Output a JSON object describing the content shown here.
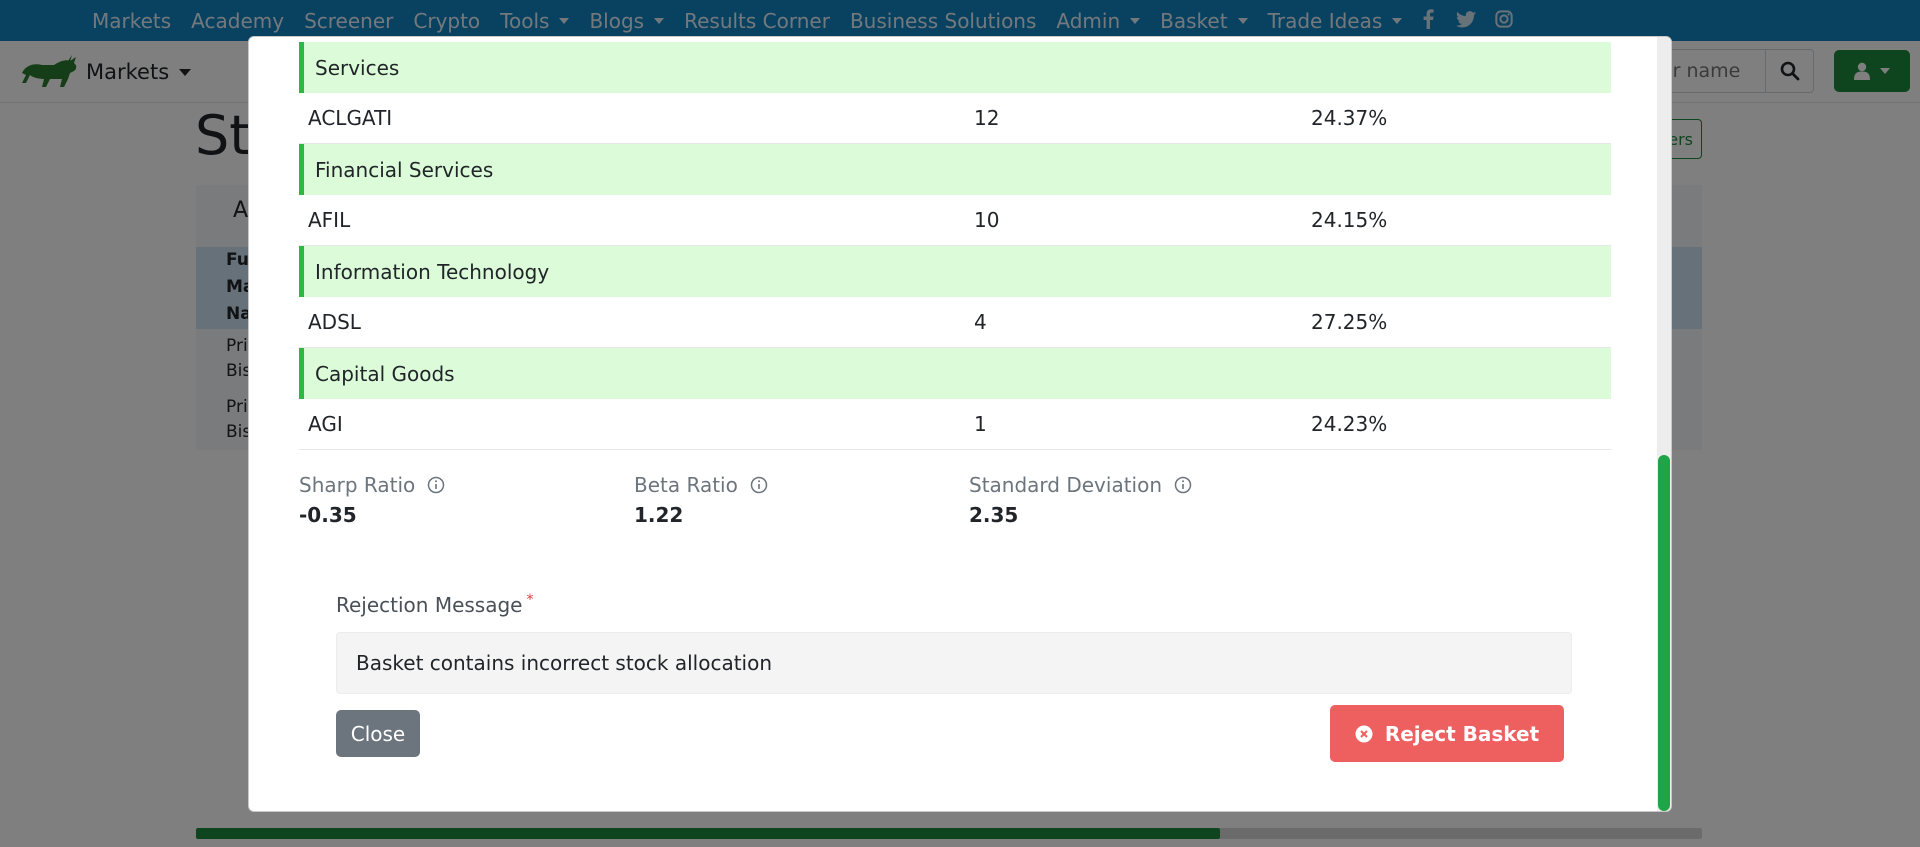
{
  "topnav": {
    "items": [
      {
        "label": "Markets",
        "dropdown": false
      },
      {
        "label": "Academy",
        "dropdown": false
      },
      {
        "label": "Screener",
        "dropdown": false
      },
      {
        "label": "Crypto",
        "dropdown": false
      },
      {
        "label": "Tools",
        "dropdown": true
      },
      {
        "label": "Blogs",
        "dropdown": true
      },
      {
        "label": "Results Corner",
        "dropdown": false
      },
      {
        "label": "Business Solutions",
        "dropdown": false
      },
      {
        "label": "Admin",
        "dropdown": true
      },
      {
        "label": "Basket",
        "dropdown": true
      },
      {
        "label": "Trade Ideas",
        "dropdown": true
      }
    ],
    "social_icons": [
      "facebook-icon",
      "twitter-icon",
      "instagram-icon"
    ],
    "bg_color": "#1385c2"
  },
  "subbar": {
    "brand_label": "Markets",
    "search_placeholder": "or name",
    "accent_color": "#1e8a3c"
  },
  "background": {
    "title_fragment": "St",
    "tab_fragment": "A",
    "header_fragments": [
      "Fu",
      "Ma",
      "Na"
    ],
    "row1_fragments": [
      "Pri",
      "Bis"
    ],
    "row2_fragments": [
      "Pri",
      "Bis"
    ],
    "filter_fragment": "ers",
    "progress": 0.68
  },
  "modal": {
    "sectors": [
      {
        "sector": "Services",
        "stock": "ACLGATI",
        "qty": "12",
        "weight": "24.37%"
      },
      {
        "sector": "Financial Services",
        "stock": "AFIL",
        "qty": "10",
        "weight": "24.15%"
      },
      {
        "sector": "Information Technology",
        "stock": "ADSL",
        "qty": "4",
        "weight": "27.25%"
      },
      {
        "sector": "Capital Goods",
        "stock": "AGI",
        "qty": "1",
        "weight": "24.23%"
      }
    ],
    "ratios": [
      {
        "label": "Sharp Ratio",
        "value": "-0.35"
      },
      {
        "label": "Beta Ratio",
        "value": "1.22"
      },
      {
        "label": "Standard Deviation",
        "value": "2.35"
      }
    ],
    "rejection_label": "Rejection Message",
    "required_mark": "*",
    "rejection_value": "Basket contains incorrect stock allocation",
    "close_label": "Close",
    "reject_label": "Reject Basket",
    "reject_color": "#ee5f5f",
    "sector_bg": "#dcfcd9",
    "sector_border": "#2eb843"
  }
}
